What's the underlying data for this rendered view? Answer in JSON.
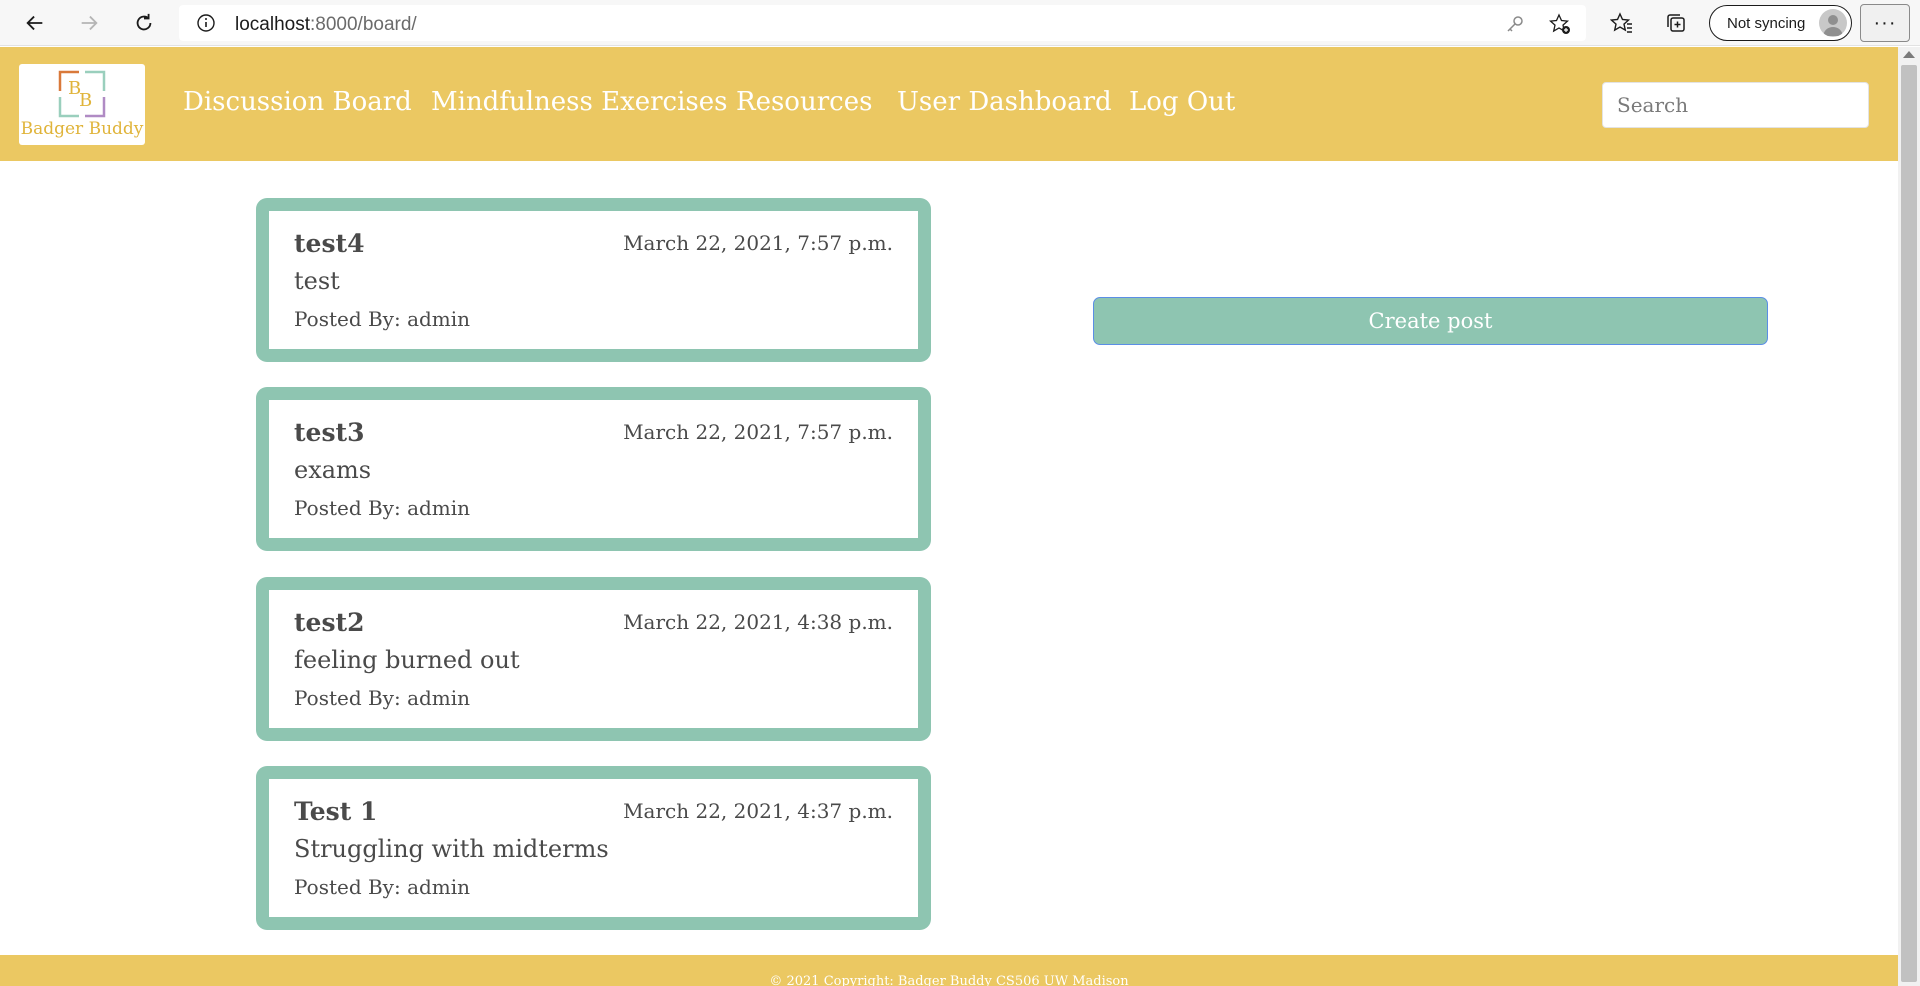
{
  "browser": {
    "url_host": "localhost",
    "url_rest": ":8000/board/",
    "sync_label": "Not syncing",
    "more_label": "···"
  },
  "header": {
    "logo_letters": "BB",
    "logo_text": "Badger Buddy",
    "nav": [
      {
        "label": "Discussion Board"
      },
      {
        "label": "Mindfulness Exercises"
      },
      {
        "label": "Resources"
      },
      {
        "label": "User Dashboard"
      },
      {
        "label": "Log Out"
      }
    ],
    "search_placeholder": "Search"
  },
  "posts": [
    {
      "title": "test4",
      "date": "March 22, 2021, 7:57 p.m.",
      "body": "test",
      "author": "Posted By: admin"
    },
    {
      "title": "test3",
      "date": "March 22, 2021, 7:57 p.m.",
      "body": "exams",
      "author": "Posted By: admin"
    },
    {
      "title": "test2",
      "date": "March 22, 2021, 4:38 p.m.",
      "body": "feeling burned out",
      "author": "Posted By: admin"
    },
    {
      "title": "Test 1",
      "date": "March 22, 2021, 4:37 p.m.",
      "body": "Struggling with midterms",
      "author": "Posted By: admin"
    }
  ],
  "create_post_label": "Create post",
  "footer": {
    "text": "© 2021 Copyright: Badger Buddy CS506 UW Madison"
  },
  "colors": {
    "header_bg": "#ebc862",
    "accent_green": "#8ec5b1",
    "text": "#4a4a4a"
  }
}
